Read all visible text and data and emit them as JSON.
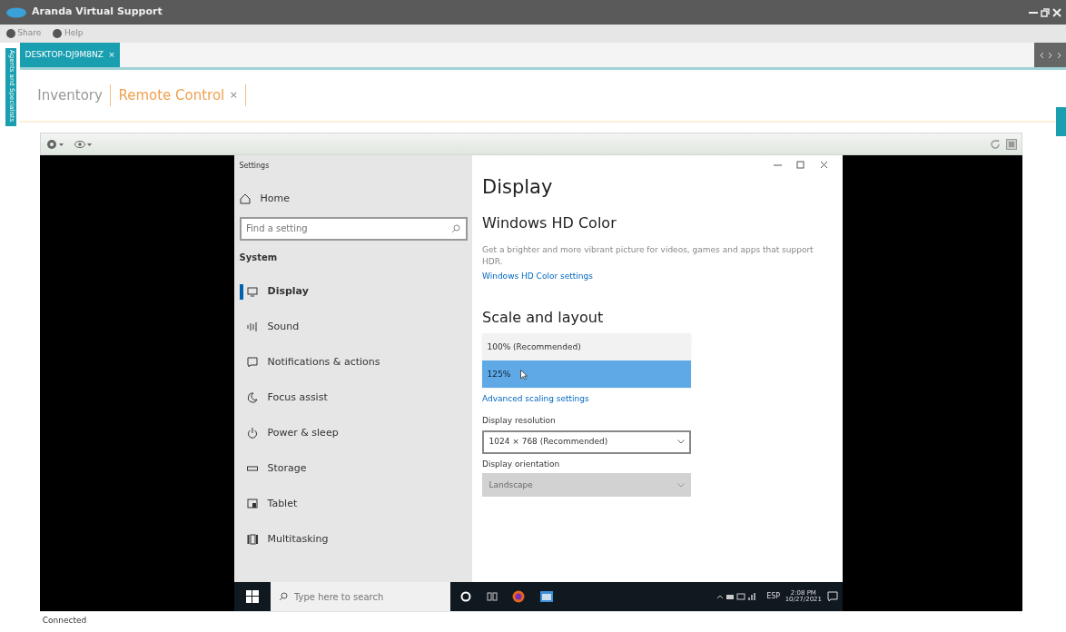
{
  "app": {
    "title": "Aranda Virtual Support"
  },
  "menu": [
    {
      "label": "Share"
    },
    {
      "label": "Help"
    }
  ],
  "side_tab": {
    "label": "Agents and Specialists"
  },
  "session_tabs": [
    {
      "label": "DESKTOP-DJ9M8NZ",
      "close": "×",
      "selected": true
    }
  ],
  "page_tabs": [
    {
      "label": "Inventory",
      "selected": false
    },
    {
      "label": "Remote Control",
      "close": "×",
      "selected": true
    }
  ],
  "settings": {
    "title": "Settings",
    "home": "Home",
    "search_placeholder": "Find a setting",
    "section": "System",
    "nav": [
      {
        "label": "Display",
        "selected": true
      },
      {
        "label": "Sound",
        "selected": false
      },
      {
        "label": "Notifications & actions",
        "selected": false
      },
      {
        "label": "Focus assist",
        "selected": false
      },
      {
        "label": "Power & sleep",
        "selected": false
      },
      {
        "label": "Storage",
        "selected": false
      },
      {
        "label": "Tablet",
        "selected": false
      },
      {
        "label": "Multitasking",
        "selected": false
      }
    ],
    "heading": "Display",
    "hd_title": "Windows HD Color",
    "hd_text": "Get a brighter and more vibrant picture for videos, games and apps that support HDR.",
    "hd_link": "Windows HD Color settings",
    "scale_title": "Scale and layout",
    "scale_options": [
      {
        "label": "100% (Recommended)",
        "selected": false
      },
      {
        "label": "125%",
        "selected": true
      }
    ],
    "scale_link": "Advanced scaling settings",
    "resolution_label": "Display resolution",
    "resolution_value": "1024 × 768 (Recommended)",
    "orientation_label": "Display orientation",
    "orientation_value": "Landscape",
    "orientation_disabled": true
  },
  "taskbar": {
    "search_placeholder": "Type here to search",
    "language": "ESP",
    "time": "2:08 PM",
    "date": "10/27/2021"
  },
  "status_bar": "Connected"
}
